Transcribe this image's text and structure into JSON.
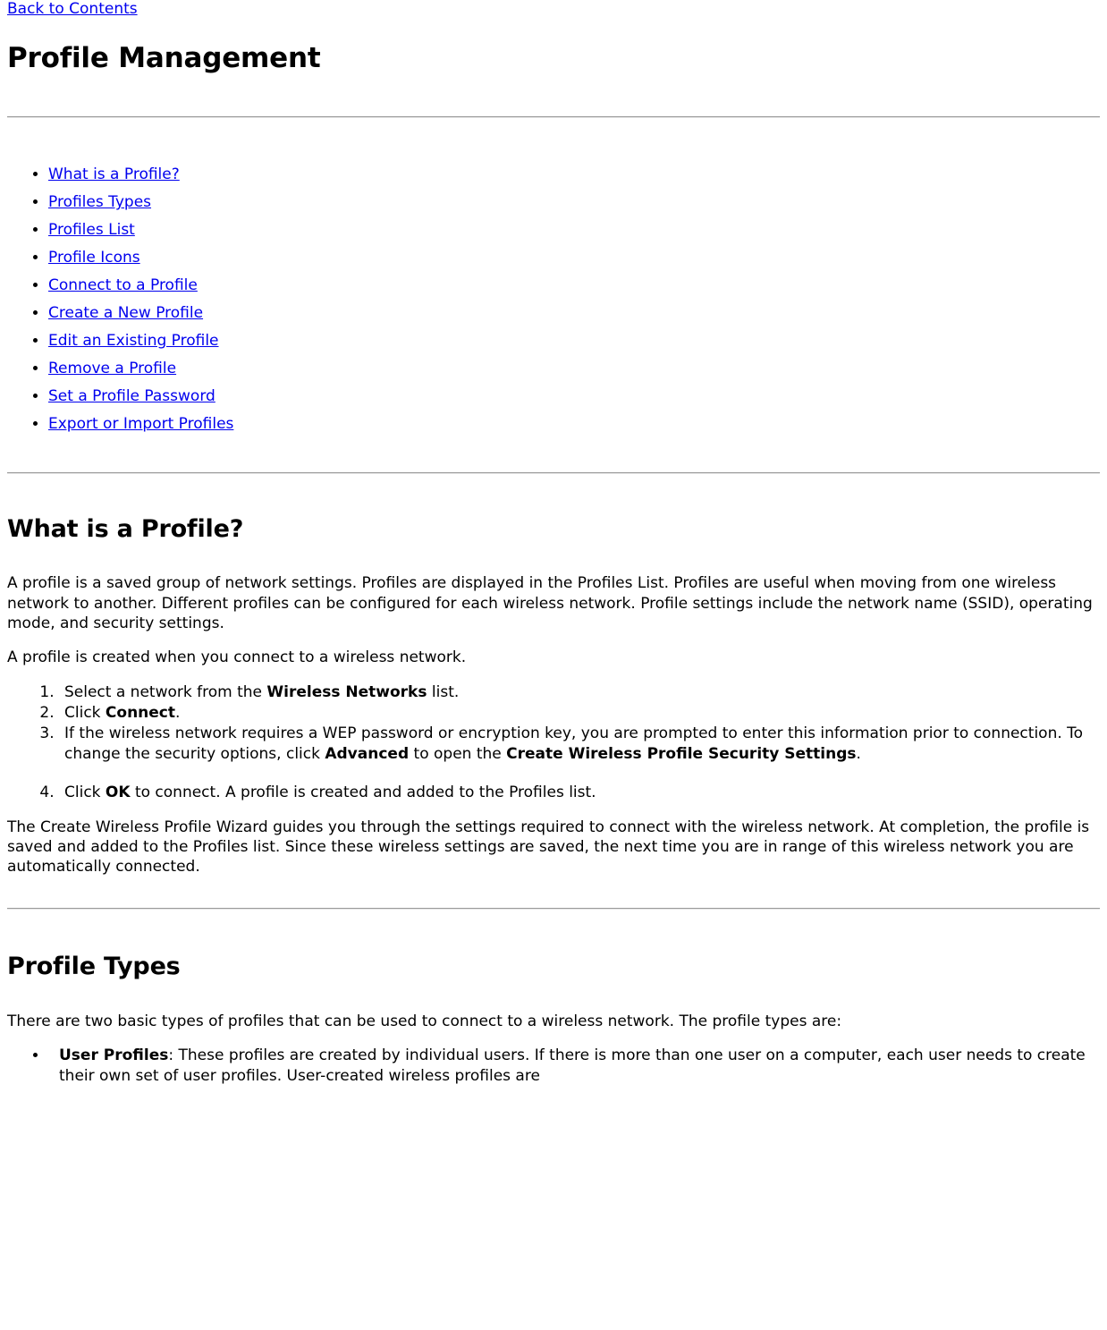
{
  "nav": {
    "back_link": "Back to Contents"
  },
  "page": {
    "title": "Profile Management"
  },
  "toc": {
    "items": [
      {
        "label": "What is a Profile?"
      },
      {
        "label": "Profiles Types"
      },
      {
        "label": "Profiles List"
      },
      {
        "label": "Profile Icons"
      },
      {
        "label": "Connect to a Profile"
      },
      {
        "label": "Create a New Profile"
      },
      {
        "label": "Edit an Existing Profile"
      },
      {
        "label": "Remove a Profile"
      },
      {
        "label": "Set a Profile Password"
      },
      {
        "label": "Export or Import Profiles"
      }
    ]
  },
  "what_is_a_profile": {
    "heading": "What is a Profile?",
    "paragraph_1": "A profile is a saved group of network settings. Profiles are displayed in the Profiles List. Profiles are useful when moving from one wireless network to another. Different profiles can be configured for each wireless network. Profile settings include the network name (SSID), operating mode, and security settings.",
    "paragraph_2": "A profile is created when you connect to a wireless network.",
    "steps": {
      "step1_pre": "Select a network from the ",
      "step1_bold": "Wireless Networks",
      "step1_post": " list.",
      "step2_pre": "Click ",
      "step2_bold": "Connect",
      "step2_post": ".",
      "step3_pre": "If the wireless network requires a WEP password or encryption key, you are prompted to enter this information prior to connection. To change the security options, click ",
      "step3_bold_a": "Advanced",
      "step3_mid": " to open the ",
      "step3_bold_b": "Create Wireless Profile Security Settings",
      "step3_post": ".",
      "step4_pre": "Click ",
      "step4_bold": "OK",
      "step4_post": " to connect. A profile is created and added to the Profiles list."
    },
    "paragraph_3": "The Create Wireless Profile Wizard guides you through the settings required to connect with the wireless network. At completion, the profile is saved and added to the Profiles list. Since these wireless settings are saved, the next time you are in range of this wireless network you are automatically connected."
  },
  "profile_types": {
    "heading": "Profile Types",
    "intro": "There are two basic types of profiles that can be used to connect to a wireless network. The profile types are:",
    "item_1_bold": "User Profiles",
    "item_1_text": ": These profiles are created by individual users. If there is more than one user on a computer, each user needs to create their own set of user profiles. User-created wireless profiles are"
  },
  "colors": {
    "link": "#0000ee",
    "text": "#000000",
    "background": "#ffffff",
    "rule_dark": "#9a9a9a",
    "rule_light": "#e6e6e6"
  }
}
